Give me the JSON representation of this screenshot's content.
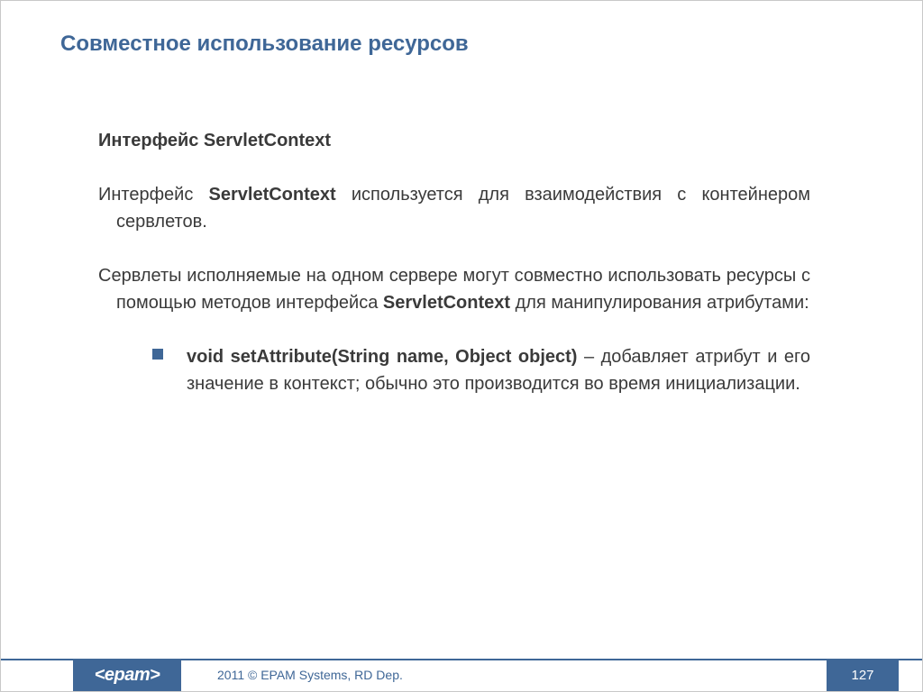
{
  "title": "Совместное использование ресурсов",
  "content": {
    "subhead": "Интерфейс ServletContext",
    "para1_pre": "Интерфейс ",
    "para1_bold": "ServletContext",
    "para1_post": " используется для взаимодействия с контейнером сервлетов.",
    "para2_pre": "Сервлеты исполняемые на одном сервере могут совместно использовать ресурсы с помощью методов интерфейса ",
    "para2_bold": "ServletContext",
    "para2_post": " для манипулирования атрибутами:",
    "bullet": {
      "lead": "void setAttribute(String name, Object object)",
      "rest": " – добавляет атрибут и его значение в контекст; обычно это производится во время инициализации."
    }
  },
  "footer": {
    "logo": "<epam>",
    "copyright": "2011 © EPAM Systems, RD Dep.",
    "page": "127"
  }
}
